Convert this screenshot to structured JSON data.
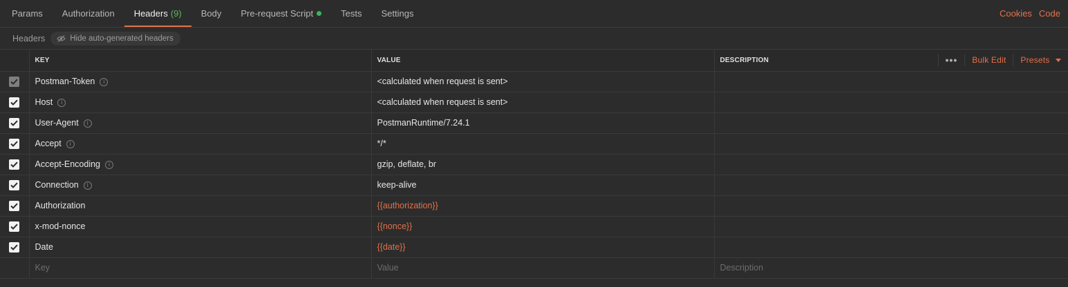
{
  "tabs": [
    {
      "label": "Params"
    },
    {
      "label": "Authorization"
    },
    {
      "label": "Headers",
      "count": "(9)",
      "active": true
    },
    {
      "label": "Body"
    },
    {
      "label": "Pre-request Script",
      "dot": true
    },
    {
      "label": "Tests"
    },
    {
      "label": "Settings"
    }
  ],
  "tab_links": {
    "cookies": "Cookies",
    "code": "Code"
  },
  "subbar": {
    "title": "Headers",
    "toggle_label": "Hide auto-generated headers"
  },
  "columns": {
    "key": "KEY",
    "value": "VALUE",
    "description": "DESCRIPTION"
  },
  "actions": {
    "more": "•••",
    "bulk_edit": "Bulk Edit",
    "presets": "Presets"
  },
  "rows": [
    {
      "key": "Postman-Token",
      "value": "<calculated when request is sent>",
      "checked": true,
      "disabled": true,
      "info": true
    },
    {
      "key": "Host",
      "value": "<calculated when request is sent>",
      "checked": true,
      "info": true
    },
    {
      "key": "User-Agent",
      "value": "PostmanRuntime/7.24.1",
      "checked": true,
      "info": true
    },
    {
      "key": "Accept",
      "value": "*/*",
      "checked": true,
      "info": true
    },
    {
      "key": "Accept-Encoding",
      "value": "gzip, deflate, br",
      "checked": true,
      "info": true
    },
    {
      "key": "Connection",
      "value": "keep-alive",
      "checked": true,
      "info": true
    },
    {
      "key": "Authorization",
      "value": "{{authorization}}",
      "checked": true,
      "variable": true
    },
    {
      "key": "x-mod-nonce",
      "value": "{{nonce}}",
      "checked": true,
      "variable": true
    },
    {
      "key": "Date",
      "value": "{{date}}",
      "checked": true,
      "variable": true
    }
  ],
  "new_row": {
    "key_placeholder": "Key",
    "value_placeholder": "Value",
    "description_placeholder": "Description"
  },
  "colors": {
    "accent": "#e4714a",
    "count": "#5fb85f",
    "dot": "#39b55a"
  }
}
